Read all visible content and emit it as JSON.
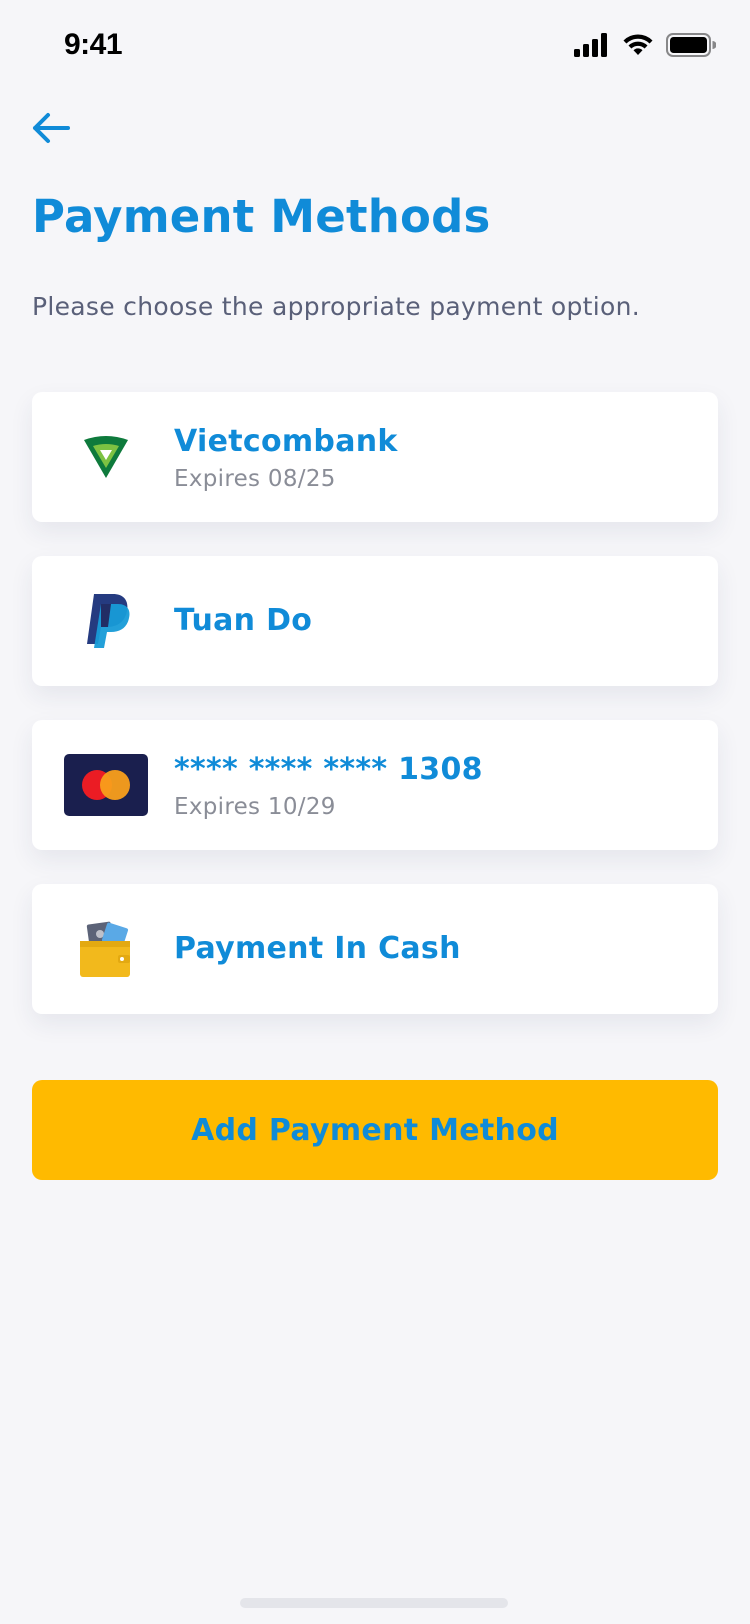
{
  "status_bar": {
    "time": "9:41",
    "icons": [
      "signal-icon",
      "wifi-icon",
      "battery-icon"
    ]
  },
  "header": {
    "back_icon": "arrow-left-icon",
    "title": "Payment Methods",
    "subtitle": "Please choose the appropriate payment option."
  },
  "methods": [
    {
      "name": "Vietcombank",
      "detail": "Expires 08/25",
      "icon": "vietcombank-logo-icon"
    },
    {
      "name": "Tuan Do",
      "detail": "",
      "icon": "paypal-logo-icon"
    },
    {
      "name": "**** **** **** 1308",
      "detail": "Expires 10/29",
      "icon": "mastercard-logo-icon"
    },
    {
      "name": "Payment In Cash",
      "detail": "",
      "icon": "cash-wallet-icon"
    }
  ],
  "actions": {
    "add_label": "Add Payment Method"
  },
  "colors": {
    "accent": "#108bd8",
    "button": "#ffba00",
    "background": "#f6f6f9",
    "subtitle": "#5a6079",
    "muted": "#8a8d97"
  }
}
